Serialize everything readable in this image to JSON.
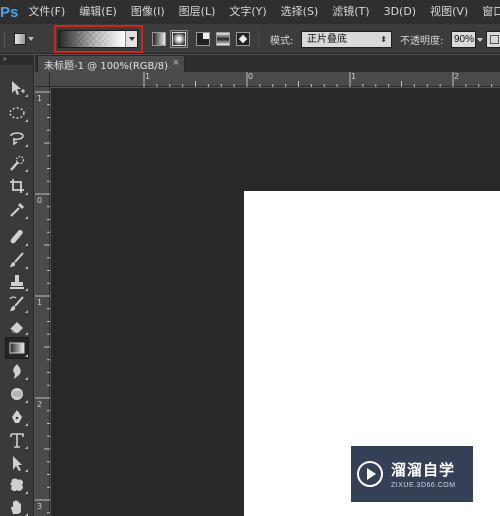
{
  "app": {
    "logo": "Ps"
  },
  "menu": [
    "文件(F)",
    "编辑(E)",
    "图像(I)",
    "图层(L)",
    "文字(Y)",
    "选择(S)",
    "滤镜(T)",
    "3D(D)",
    "视图(V)",
    "窗口"
  ],
  "options_bar": {
    "tool_preset_icon": "gradient-tool-preset-icon",
    "gradient_picker": {
      "highlighted": true,
      "highlight_color": "#d42121"
    },
    "gradient_types": [
      "linear-gradient-icon",
      "radial-gradient-icon",
      "angle-gradient-icon",
      "reflected-gradient-icon",
      "diamond-gradient-icon"
    ],
    "selected_gradient_type": "radial-gradient-icon",
    "mode_label": "模式:",
    "mode_value": "正片叠底",
    "opacity_label": "不透明度:",
    "opacity_value": "90%"
  },
  "document_tab": {
    "title": "未标题-1 @ 100%(RGB/8)",
    "close": "×"
  },
  "rulers": {
    "horizontal": [
      "1",
      "0",
      "1",
      "2"
    ],
    "vertical": [
      "1",
      "0",
      "1",
      "2",
      "3"
    ]
  },
  "toolbox": {
    "header": "››",
    "active_tool": "gradient-tool-icon",
    "tools": [
      "move-tool-icon",
      "marquee-tool-icon",
      "lasso-tool-icon",
      "quick-selection-tool-icon",
      "crop-tool-icon",
      "eyedropper-tool-icon",
      "healing-brush-tool-icon",
      "brush-tool-icon",
      "clone-stamp-tool-icon",
      "history-brush-tool-icon",
      "eraser-tool-icon",
      "gradient-tool-icon",
      "blur-tool-icon",
      "dodge-tool-icon",
      "pen-tool-icon",
      "type-tool-icon",
      "path-selection-tool-icon",
      "shape-tool-icon",
      "hand-tool-icon"
    ]
  },
  "watermark": {
    "title": "溜溜自学",
    "url": "ZIXUE.3D66.COM"
  },
  "colors": {
    "menubar": "#2f2f2f",
    "optionsbar": "#3c3c3c",
    "pasteboard": "#282828",
    "canvas": "#ffffff",
    "accent_blue": "#4fa3e6"
  }
}
